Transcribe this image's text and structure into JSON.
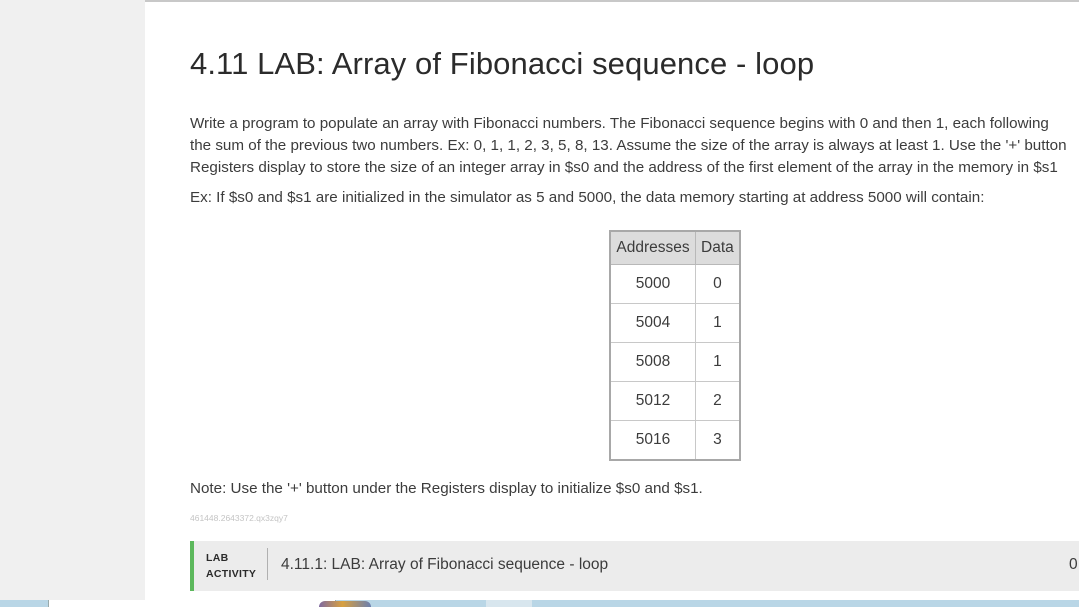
{
  "page": {
    "title": "4.11 LAB: Array of Fibonacci sequence - loop",
    "description_lines": [
      "Write a program to populate an array with Fibonacci numbers. The Fibonacci sequence begins with 0 and then 1, each following",
      "the sum of the previous two numbers. Ex: 0, 1, 1, 2, 3, 5, 8, 13. Assume the size of the array is always at least 1. Use the '+' button",
      "Registers display to store the size of an integer array in $s0 and the address of the first element of the array in the memory in $s1"
    ],
    "example_text": "Ex: If $s0 and $s1 are initialized in the simulator as 5 and 5000, the data memory starting at address 5000 will contain:",
    "note_text": "Note: Use the '+' button under the Registers display to initialize $s0 and $s1.",
    "tag_text": "461448.2643372.qx3zqy7"
  },
  "memory_table": {
    "headers": [
      "Addresses",
      "Data"
    ],
    "rows": [
      {
        "address": "5000",
        "data": "0"
      },
      {
        "address": "5004",
        "data": "1"
      },
      {
        "address": "5008",
        "data": "1"
      },
      {
        "address": "5012",
        "data": "2"
      },
      {
        "address": "5016",
        "data": "3"
      }
    ]
  },
  "lab_activity": {
    "label_line1": "LAB",
    "label_line2": "ACTIVITY",
    "title": "4.11.1: LAB: Array of Fibonacci sequence - loop",
    "score": "0",
    "accent_color": "#5cb85c"
  }
}
